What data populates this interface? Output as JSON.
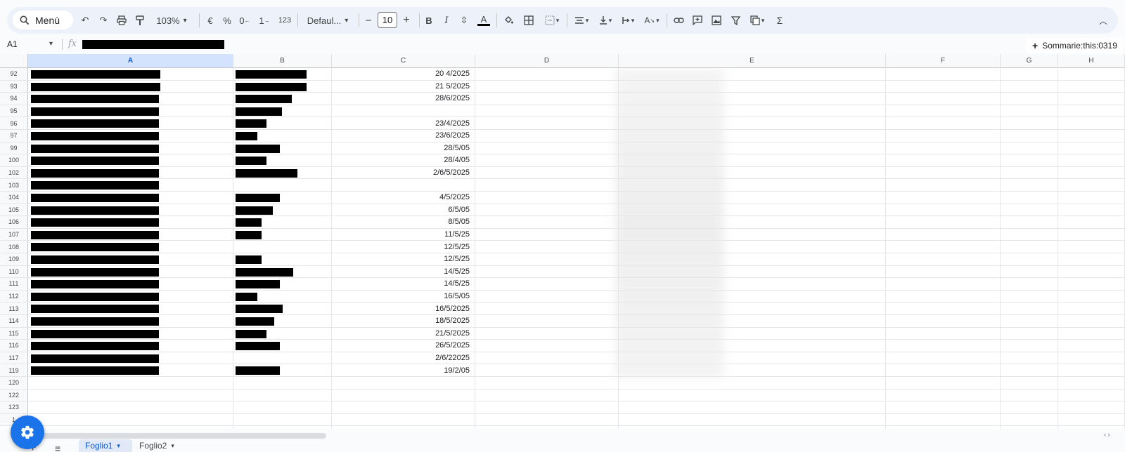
{
  "toolbar": {
    "search_label": "Menù",
    "zoom": "103%",
    "currency": "€",
    "percent": "%",
    "decimal_decrease": "0",
    "decimal_increase": "1",
    "format_number": "123",
    "font_name": "Defaul...",
    "minus": "−",
    "font_size": "10",
    "plus": "+",
    "bold": "B",
    "italic": "I",
    "text_color": "A",
    "sum": "Σ"
  },
  "formula_bar": {
    "cell_ref": "A1",
    "fx": "fx"
  },
  "sommarie_button": "Sommarie:this:0319",
  "columns": [
    "A",
    "B",
    "C",
    "D",
    "E",
    "F",
    "G",
    "H"
  ],
  "selected_column": "A",
  "rows": [
    {
      "num": "92",
      "date": "20 4/2025",
      "a": true,
      "b": 1.0
    },
    {
      "num": "93",
      "date": "21 5/2025",
      "a": true,
      "b": 1.0
    },
    {
      "num": "94",
      "date": "28/6/2025",
      "a": true,
      "b": 0.79
    },
    {
      "num": "95",
      "date": "",
      "a": true,
      "b": 0.65
    },
    {
      "num": "96",
      "date": "23/4/2025",
      "a": true,
      "b": 0.44
    },
    {
      "num": "97",
      "date": "23/6/2025",
      "a": true,
      "b": 0.31
    },
    {
      "num": "99",
      "date": "28/5/05",
      "a": true,
      "b": 0.62
    },
    {
      "num": "100",
      "date": "28/4/05",
      "a": true,
      "b": 0.44
    },
    {
      "num": "102",
      "date": "2/6/5/2025",
      "a": true,
      "b": 0.87
    },
    {
      "num": "103",
      "date": "",
      "a": true,
      "b": 0
    },
    {
      "num": "104",
      "date": "4/5/2025",
      "a": true,
      "b": 0.62
    },
    {
      "num": "105",
      "date": "6/5/05",
      "a": true,
      "b": 0.52
    },
    {
      "num": "106",
      "date": "8/5/05",
      "a": true,
      "b": 0.37
    },
    {
      "num": "107",
      "date": "11/5/25",
      "a": true,
      "b": 0.37
    },
    {
      "num": "108",
      "date": "12/5/25",
      "a": true,
      "b": 0
    },
    {
      "num": "109",
      "date": "12/5/25",
      "a": true,
      "b": 0.37
    },
    {
      "num": "110",
      "date": "14/5/25",
      "a": true,
      "b": 0.81
    },
    {
      "num": "111",
      "date": "14/5/25",
      "a": true,
      "b": 0.62
    },
    {
      "num": "112",
      "date": "16/5/05",
      "a": true,
      "b": 0.31
    },
    {
      "num": "113",
      "date": "16/5/2025",
      "a": true,
      "b": 0.66
    },
    {
      "num": "114",
      "date": "18/5/2025",
      "a": true,
      "b": 0.54
    },
    {
      "num": "115",
      "date": "21/5/2025",
      "a": true,
      "b": 0.44
    },
    {
      "num": "116",
      "date": "26/5/2025",
      "a": true,
      "b": 0.62
    },
    {
      "num": "117",
      "date": "2/6/22025",
      "a": true,
      "b": 0
    },
    {
      "num": "119",
      "date": "19/2/05",
      "a": true,
      "b": 0.62
    },
    {
      "num": "120",
      "date": "",
      "a": false,
      "b": 0
    },
    {
      "num": "122",
      "date": "",
      "a": false,
      "b": 0
    },
    {
      "num": "123",
      "date": "",
      "a": false,
      "b": 0
    },
    {
      "num": "1",
      "date": "",
      "a": false,
      "b": 0
    }
  ],
  "sheets": [
    {
      "label": "Foglio1",
      "active": true
    },
    {
      "label": "Foglio2",
      "active": false
    }
  ],
  "colors": {
    "accent": "#1a73e8",
    "selected_header": "#d3e3fd",
    "redaction": "#000000"
  }
}
